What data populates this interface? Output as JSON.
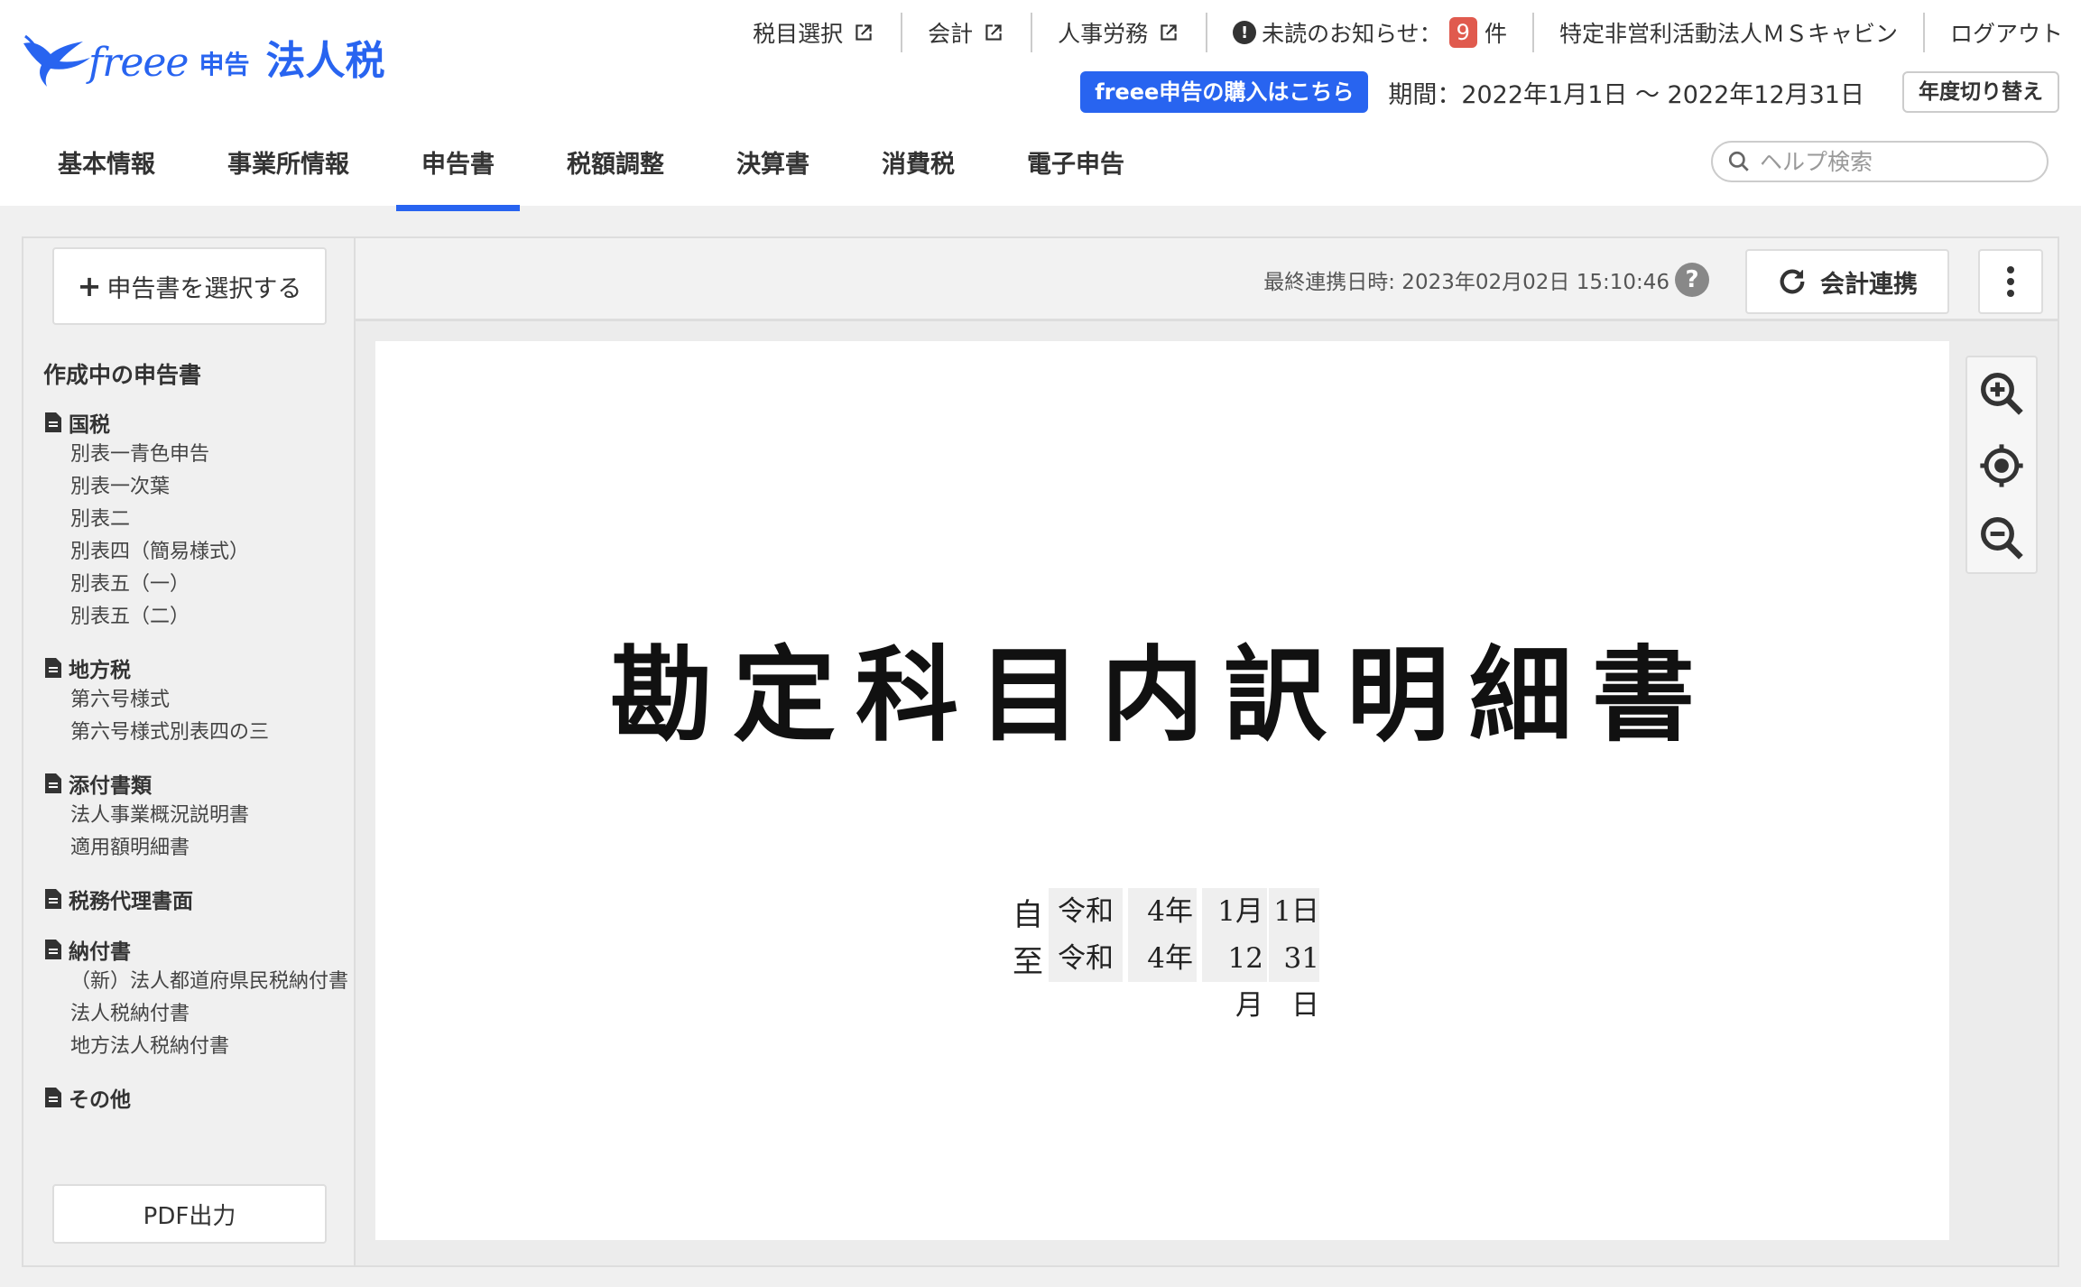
{
  "app": {
    "logo_main": "freee",
    "logo_sub": "申告",
    "product": "法人税"
  },
  "toplinks": {
    "tax_select": "税目選択",
    "accounting": "会計",
    "hr": "人事労務",
    "notice_prefix": "未読のお知らせ：",
    "notice_count": "9",
    "notice_suffix": "件",
    "company": "特定非営利活動法人ＭＳキャビン",
    "logout": "ログアウト"
  },
  "period_row": {
    "buy_label": "freee申告の購入はこちら",
    "period_text": "期間：2022年1月1日 〜 2022年12月31日",
    "switch_label": "年度切り替え"
  },
  "tabs": [
    {
      "label": "基本情報"
    },
    {
      "label": "事業所情報"
    },
    {
      "label": "申告書"
    },
    {
      "label": "税額調整"
    },
    {
      "label": "決算書"
    },
    {
      "label": "消費税"
    },
    {
      "label": "電子申告"
    }
  ],
  "search": {
    "placeholder": "ヘルプ検索"
  },
  "sidebar": {
    "select_label": "申告書を選択する",
    "section_title": "作成中の申告書",
    "categories": [
      {
        "name": "国税",
        "items": [
          "別表一青色申告",
          "別表一次葉",
          "別表二",
          "別表四（簡易様式）",
          "別表五（一）",
          "別表五（二）"
        ]
      },
      {
        "name": "地方税",
        "items": [
          "第六号様式",
          "第六号様式別表四の三"
        ]
      },
      {
        "name": "添付書類",
        "items": [
          "法人事業概況説明書",
          "適用額明細書"
        ]
      },
      {
        "name": "税務代理書面",
        "items": []
      },
      {
        "name": "納付書",
        "items": [
          "（新）法人都道府県民税納付書",
          "法人税納付書",
          "地方法人税納付書"
        ]
      },
      {
        "name": "その他",
        "items": []
      }
    ],
    "pdf_label": "PDF出力"
  },
  "toolbar": {
    "last_sync": "最終連携日時: 2023年02月02日 15:10:46",
    "sync_label": "会計連携"
  },
  "document": {
    "title": "勘定科目内訳明細書",
    "from_label": "自",
    "to_label": "至",
    "from": {
      "era": "令和",
      "year": "4年",
      "month": "1月",
      "day": "1日"
    },
    "to": {
      "era": "令和",
      "year": "4年",
      "month": "12月",
      "day": "31日"
    }
  },
  "colors": {
    "brand": "#2864f0",
    "badge": "#e05a4e"
  },
  "active_tab": "申告書"
}
